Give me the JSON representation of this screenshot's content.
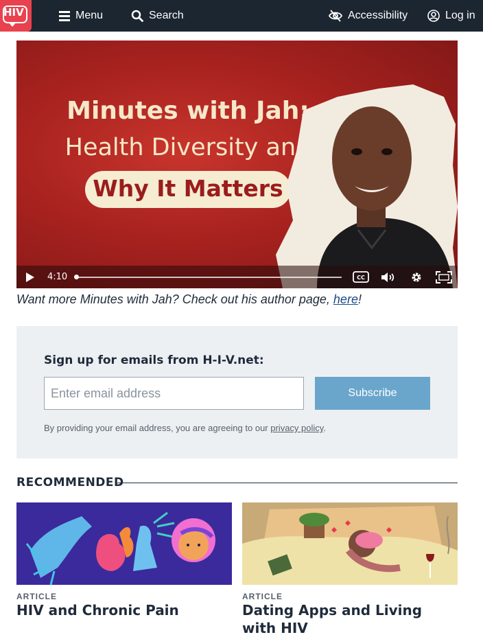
{
  "header": {
    "logo_text": "HIV",
    "menu_label": "Menu",
    "search_label": "Search",
    "accessibility_label": "Accessibility",
    "login_label": "Log in"
  },
  "video": {
    "title_line1": "Minutes with Jah:",
    "title_line2": "Health Diversity and",
    "title_line3": "Why It Matters",
    "duration": "4:10",
    "progress": 0
  },
  "caption": {
    "text_before": "Want more Minutes with Jah? Check out his author page, ",
    "link_text": "here",
    "text_after": "!"
  },
  "signup": {
    "title": "Sign up for emails from H-I-V.net:",
    "email_placeholder": "Enter email address",
    "subscribe_label": "Subscribe",
    "legal_before": "By providing your email address, you are agreeing to our ",
    "legal_link": "privacy policy",
    "legal_after": "."
  },
  "recommended": {
    "heading": "RECOMMENDED",
    "cards": [
      {
        "kicker": "ARTICLE",
        "title": "HIV and Chronic Pain"
      },
      {
        "kicker": "ARTICLE",
        "title": "Dating Apps and Living with HIV"
      }
    ]
  },
  "colors": {
    "header_bg": "#1c2631",
    "brand_red": "#e8424f",
    "subscribe_bg": "#6aa6cc",
    "signup_bg": "#edf0f3"
  }
}
